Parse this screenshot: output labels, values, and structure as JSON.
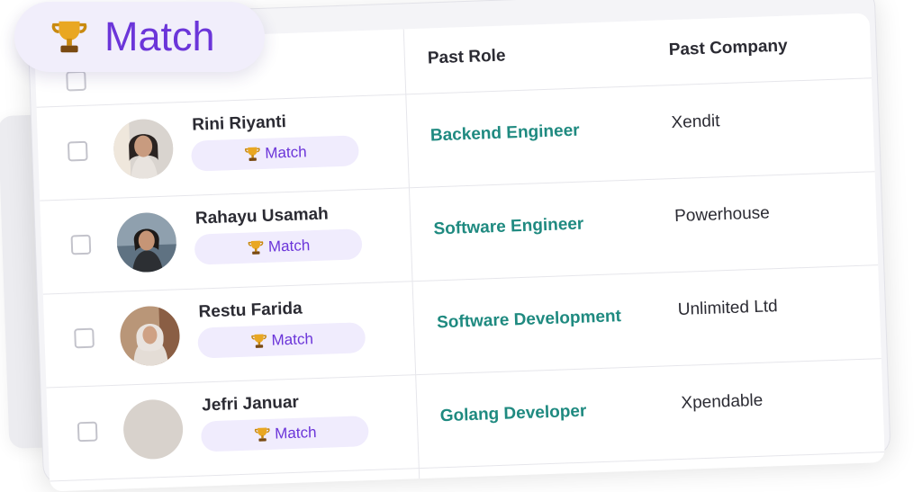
{
  "floating_badge": {
    "icon": "trophy-icon",
    "label": "Match"
  },
  "table": {
    "columns": {
      "role": "Past Role",
      "company": "Past Company"
    },
    "rows": [
      {
        "name": "Rini Riyanti",
        "badge": "Match",
        "role": "Backend Engineer",
        "company": "Xendit",
        "avatar": "avatar-photo"
      },
      {
        "name": "Rahayu Usamah",
        "badge": "Match",
        "role": "Software Engineer",
        "company": "Powerhouse",
        "avatar": "avatar-photo"
      },
      {
        "name": "Restu Farida",
        "badge": "Match",
        "role": "Software Development",
        "company": "Unlimited Ltd",
        "avatar": "avatar-photo"
      },
      {
        "name": "Jefri Januar",
        "badge": "Match",
        "role": "Golang Developer",
        "company": "Xpendable",
        "avatar": "avatar-photo"
      }
    ]
  },
  "colors": {
    "accent": "#6b35d9",
    "badge_bg": "#f0ecfd",
    "role_text": "#1f8a80",
    "text": "#2b2b33"
  }
}
